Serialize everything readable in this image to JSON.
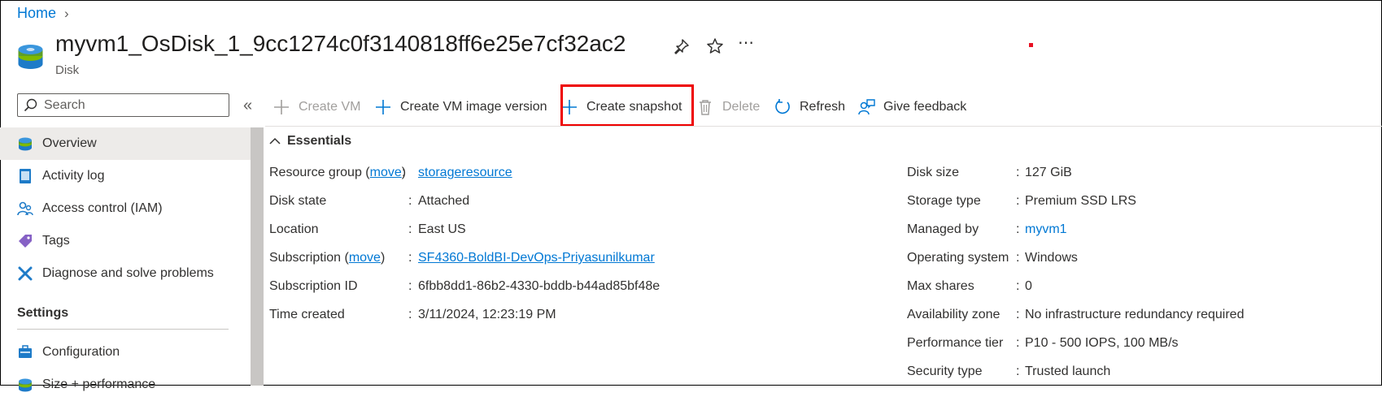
{
  "breadcrumb": {
    "home": "Home"
  },
  "header": {
    "title": "myvm1_OsDisk_1_9cc1274c0f3140818ff6e25e7cf32ac2",
    "subtitle": "Disk"
  },
  "search": {
    "placeholder": "Search"
  },
  "sidebar": {
    "items": [
      {
        "label": "Overview",
        "icon": "disk-icon"
      },
      {
        "label": "Activity log",
        "icon": "activity-log-icon"
      },
      {
        "label": "Access control (IAM)",
        "icon": "iam-icon"
      },
      {
        "label": "Tags",
        "icon": "tag-icon"
      },
      {
        "label": "Diagnose and solve problems",
        "icon": "wrench-icon"
      }
    ],
    "settings_title": "Settings",
    "settings_items": [
      {
        "label": "Configuration",
        "icon": "configuration-icon"
      },
      {
        "label": "Size + performance",
        "icon": "disk-icon"
      }
    ]
  },
  "toolbar": {
    "create_vm": "Create VM",
    "create_vm_image": "Create VM image version",
    "create_snapshot": "Create snapshot",
    "delete": "Delete",
    "refresh": "Refresh",
    "feedback": "Give feedback"
  },
  "essentials": {
    "heading": "Essentials",
    "move_label": "move",
    "left": [
      {
        "label": "Resource group",
        "value": "storageresource"
      },
      {
        "label": "Disk state",
        "value": "Attached"
      },
      {
        "label": "Location",
        "value": "East US"
      },
      {
        "label": "Subscription",
        "value": "SF4360-BoldBI-DevOps-Priyasunilkumar"
      },
      {
        "label": "Subscription ID",
        "value": "6fbb8dd1-86b2-4330-bddb-b44ad85bf48e"
      },
      {
        "label": "Time created",
        "value": "3/11/2024, 12:23:19 PM"
      }
    ],
    "right": [
      {
        "label": "Disk size",
        "value": "127 GiB"
      },
      {
        "label": "Storage type",
        "value": "Premium SSD LRS"
      },
      {
        "label": "Managed by",
        "value": "myvm1"
      },
      {
        "label": "Operating system",
        "value": "Windows"
      },
      {
        "label": "Max shares",
        "value": "0"
      },
      {
        "label": "Availability zone",
        "value": "No infrastructure redundancy required"
      },
      {
        "label": "Performance tier",
        "value": "P10 - 500 IOPS, 100 MB/s"
      },
      {
        "label": "Security type",
        "value": "Trusted launch"
      }
    ],
    "separator": ":"
  },
  "colors": {
    "accent": "#0078d4",
    "highlight": "#e00000"
  }
}
